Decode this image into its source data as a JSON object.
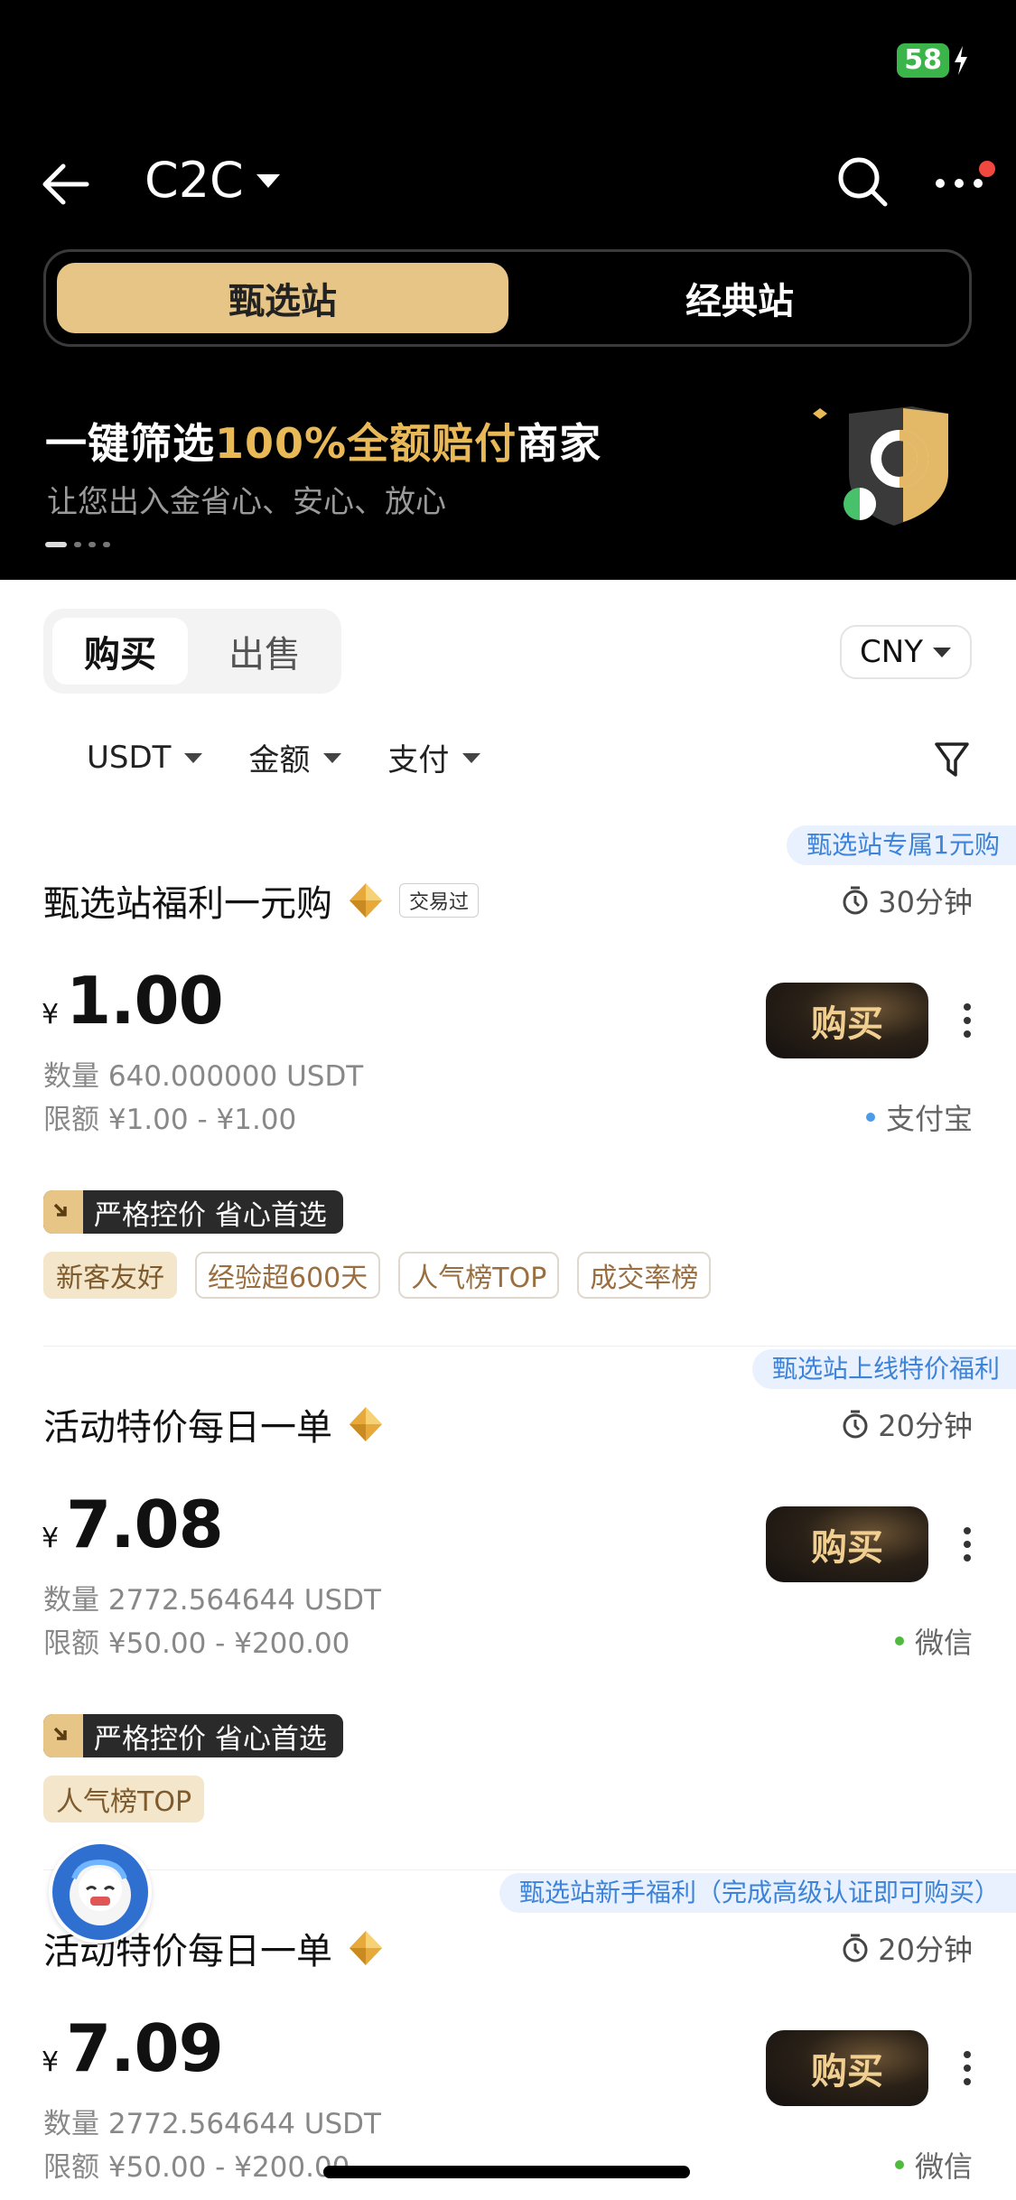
{
  "status": {
    "battery": "58"
  },
  "header": {
    "title": "C2C"
  },
  "station_tabs": {
    "selected": "甄选站",
    "other": "经典站"
  },
  "banner": {
    "title_prefix": "一键筛选",
    "title_highlight": "100%全额赔付",
    "title_suffix": "商家",
    "subtitle": "让您出入金省心、安心、放心"
  },
  "trade_tabs": {
    "buy": "购买",
    "sell": "出售"
  },
  "currency": "CNY",
  "filters": [
    "USDT",
    "金额",
    "支付"
  ],
  "offers": [
    {
      "promo": "甄选站专属1元购",
      "merchant": "甄选站福利一元购",
      "traded_badge": "交易过",
      "time": "30分钟",
      "currency_symbol": "¥",
      "price": "1.00",
      "quantity": "数量 640.000000 USDT",
      "limit": "限额 ¥1.00 - ¥1.00",
      "buy_label": "购买",
      "payment": "支付宝",
      "payment_color": "#4a9be8",
      "strict_label": "严格控价 省心首选",
      "tags": [
        "新客友好",
        "经验超600天",
        "人气榜TOP",
        "成交率榜"
      ]
    },
    {
      "promo": "甄选站上线特价福利",
      "merchant": "活动特价每日一单",
      "time": "20分钟",
      "currency_symbol": "¥",
      "price": "7.08",
      "quantity": "数量 2772.564644 USDT",
      "limit": "限额 ¥50.00 - ¥200.00",
      "buy_label": "购买",
      "payment": "微信",
      "payment_color": "#4fba3e",
      "strict_label": "严格控价 省心首选",
      "tags": [
        "人气榜TOP"
      ]
    },
    {
      "promo": "甄选站新手福利（完成高级认证即可购买）",
      "merchant": "活动特价每日一单",
      "time": "20分钟",
      "currency_symbol": "¥",
      "price": "7.09",
      "quantity": "数量 2772.564644 USDT",
      "limit": "限额 ¥50.00 - ¥200.00",
      "buy_label": "购买",
      "payment": "微信",
      "payment_color": "#4fba3e"
    }
  ]
}
